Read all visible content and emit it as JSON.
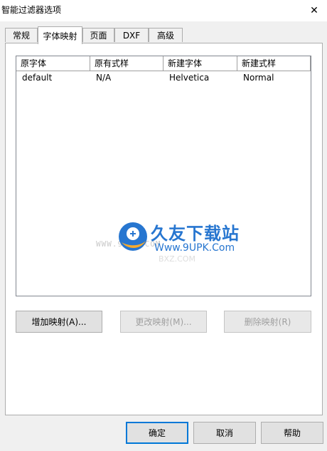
{
  "window": {
    "title": "智能过滤器选项",
    "close_glyph": "✕"
  },
  "tabs": [
    {
      "label": "常规",
      "active": false
    },
    {
      "label": "字体映射",
      "active": true
    },
    {
      "label": "页面",
      "active": false
    },
    {
      "label": "DXF",
      "active": false
    },
    {
      "label": "高级",
      "active": false
    }
  ],
  "font_map": {
    "columns": [
      "原字体",
      "原有式样",
      "新建字体",
      "新建式样"
    ],
    "rows": [
      [
        "default",
        "N/A",
        "Helvetica",
        "Normal"
      ]
    ]
  },
  "panel_buttons": {
    "add": "增加映射(A)...",
    "change": "更改映射(M)...",
    "delete": "删除映射(R)"
  },
  "dialog_buttons": {
    "ok": "确定",
    "cancel": "取消",
    "help": "帮助"
  },
  "watermark": {
    "cn": "久友下载站",
    "url": "Www.9UPK.Com",
    "url_left": "WWW.9UPK.COM",
    "ghost": "BXZ.COM"
  },
  "colors": {
    "accent": "#0078d7",
    "watermark_blue": "#1c6fce",
    "watermark_orange": "#f5a623"
  }
}
